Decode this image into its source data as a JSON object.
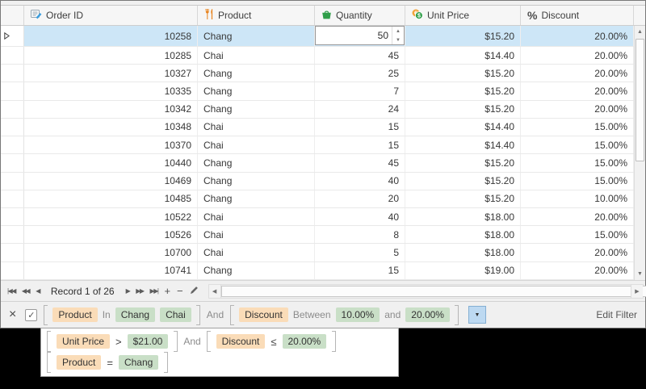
{
  "grid": {
    "columns": [
      {
        "id": "order_id",
        "label": "Order ID"
      },
      {
        "id": "product",
        "label": "Product"
      },
      {
        "id": "quantity",
        "label": "Quantity"
      },
      {
        "id": "unit_price",
        "label": "Unit Price"
      },
      {
        "id": "discount",
        "label": "Discount"
      }
    ],
    "rows": [
      {
        "order_id": "10258",
        "product": "Chang",
        "quantity": "50",
        "unit_price": "$15.20",
        "discount": "20.00%"
      },
      {
        "order_id": "10285",
        "product": "Chai",
        "quantity": "45",
        "unit_price": "$14.40",
        "discount": "20.00%"
      },
      {
        "order_id": "10327",
        "product": "Chang",
        "quantity": "25",
        "unit_price": "$15.20",
        "discount": "20.00%"
      },
      {
        "order_id": "10335",
        "product": "Chang",
        "quantity": "7",
        "unit_price": "$15.20",
        "discount": "20.00%"
      },
      {
        "order_id": "10342",
        "product": "Chang",
        "quantity": "24",
        "unit_price": "$15.20",
        "discount": "20.00%"
      },
      {
        "order_id": "10348",
        "product": "Chai",
        "quantity": "15",
        "unit_price": "$14.40",
        "discount": "15.00%"
      },
      {
        "order_id": "10370",
        "product": "Chai",
        "quantity": "15",
        "unit_price": "$14.40",
        "discount": "15.00%"
      },
      {
        "order_id": "10440",
        "product": "Chang",
        "quantity": "45",
        "unit_price": "$15.20",
        "discount": "15.00%"
      },
      {
        "order_id": "10469",
        "product": "Chang",
        "quantity": "40",
        "unit_price": "$15.20",
        "discount": "15.00%"
      },
      {
        "order_id": "10485",
        "product": "Chang",
        "quantity": "20",
        "unit_price": "$15.20",
        "discount": "10.00%"
      },
      {
        "order_id": "10522",
        "product": "Chai",
        "quantity": "40",
        "unit_price": "$18.00",
        "discount": "20.00%"
      },
      {
        "order_id": "10526",
        "product": "Chai",
        "quantity": "8",
        "unit_price": "$18.00",
        "discount": "15.00%"
      },
      {
        "order_id": "10700",
        "product": "Chai",
        "quantity": "5",
        "unit_price": "$18.00",
        "discount": "20.00%"
      },
      {
        "order_id": "10741",
        "product": "Chang",
        "quantity": "15",
        "unit_price": "$19.00",
        "discount": "20.00%"
      }
    ],
    "selected_row_index": 0,
    "editing_row_index": 0,
    "quantity_editor": {
      "value": "50"
    }
  },
  "navigator": {
    "record_label": "Record 1 of 26",
    "buttons": {
      "first": "|◀◀",
      "prev_page": "◀◀",
      "prev": "◀",
      "next": "▶",
      "next_page": "▶▶",
      "last": "▶▶|",
      "append": "+",
      "remove": "−"
    }
  },
  "filter_panel": {
    "checkbox_checked": true,
    "groups": [
      {
        "column": "Product",
        "operator": "In",
        "values": [
          "Chang",
          "Chai"
        ]
      },
      {
        "column": "Discount",
        "operator": "Between",
        "value_low": "10.00%",
        "joiner": "and",
        "value_high": "20.00%"
      }
    ],
    "group_joiner": "And",
    "edit_filter_label": "Edit Filter"
  },
  "filter_history_popup": {
    "items": [
      {
        "joiner": "And",
        "clauses": [
          {
            "column": "Unit Price",
            "operator": ">",
            "value": "$21.00"
          },
          {
            "column": "Discount",
            "operator": "≤",
            "value": "20.00%"
          }
        ]
      },
      {
        "clauses": [
          {
            "column": "Product",
            "operator": "=",
            "value": "Chang"
          }
        ]
      }
    ]
  },
  "icons": {
    "close": "×",
    "check": "✓",
    "dropdown_arrow": "▼",
    "spin_up": "▲",
    "spin_down": "▼",
    "scroll_up": "▲",
    "scroll_down": "▼",
    "scroll_left": "◀",
    "scroll_right": "▶",
    "percent": "%"
  },
  "colors": {
    "selection": "#cde6f7",
    "chip_column": "#fadcb8",
    "chip_value": "#c9dfc7",
    "dropdown_button": "#bdd9f1",
    "backdrop": "#000000"
  }
}
